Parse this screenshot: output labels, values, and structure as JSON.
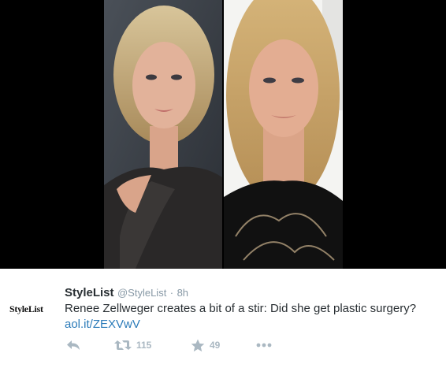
{
  "tweet": {
    "avatar_text": "StyleList",
    "display_name": "StyleList",
    "handle": "@StyleList",
    "separator": "·",
    "time": "8h",
    "text": "Renee Zellweger creates a bit of a stir: Did she get plastic surgery?",
    "link": "aol.it/ZEXVwV",
    "retweet_count": "115",
    "favorite_count": "49"
  },
  "icons": {
    "reply": "reply-icon",
    "retweet": "retweet-icon",
    "favorite": "star-icon",
    "more": "more-icon"
  },
  "colors": {
    "link": "#2b7bb9",
    "muted": "#8899a6",
    "action": "#aab8c2",
    "text": "#292f33"
  }
}
